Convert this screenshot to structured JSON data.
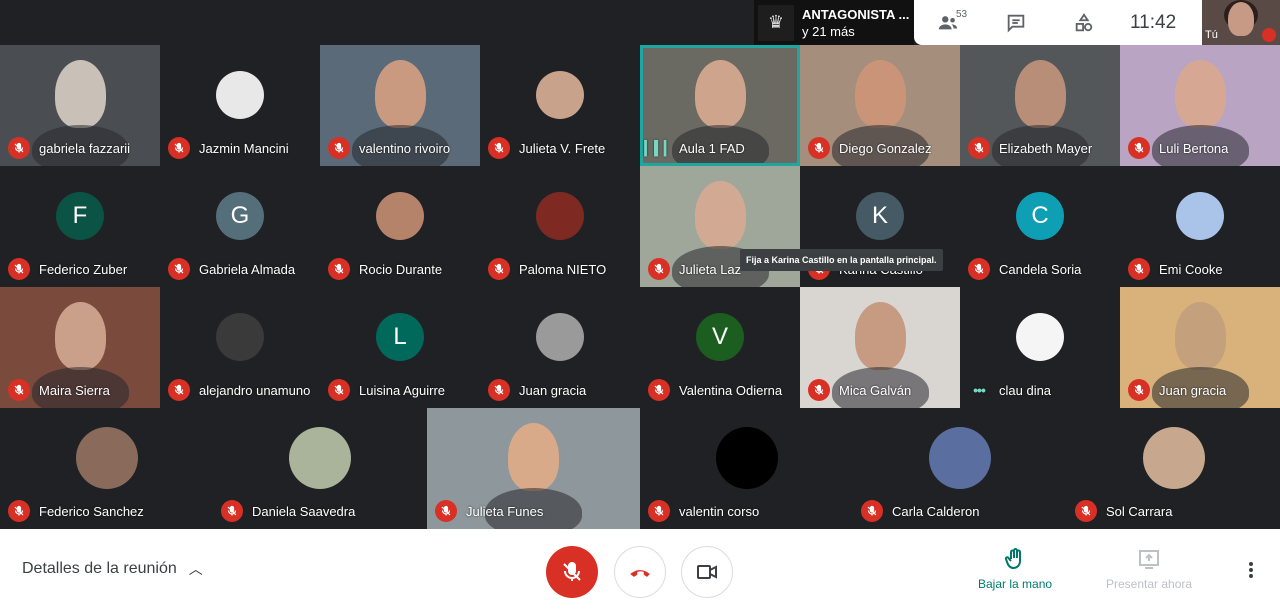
{
  "presenter": {
    "line1": "ANTAGONISTA ...",
    "line2": "y 21 más"
  },
  "toolbar": {
    "participants_count": "53",
    "time": "11:42"
  },
  "self_tile": {
    "label": "Tú"
  },
  "tooltip": "Fija a Karina Castillo en la pantalla principal.",
  "icons": [
    "people-icon",
    "chat-icon",
    "activities-icon",
    "mic-off-icon",
    "hangup-icon",
    "camera-icon",
    "raise-hand-icon",
    "present-icon",
    "more-icon",
    "chevron-up-icon"
  ],
  "colors": {
    "muted": "#d93025",
    "active_speaker": "#1ea7a0",
    "raise_hand": "#00796b"
  },
  "tiles": [
    {
      "name": "gabriela fazzarii"
    },
    {
      "name": "Jazmin Mancini"
    },
    {
      "name": "valentino rivoiro"
    },
    {
      "name": "Julieta V. Frete"
    },
    {
      "name": "Aula 1 FAD"
    },
    {
      "name": "Diego Gonzalez"
    },
    {
      "name": "Elizabeth Mayer"
    },
    {
      "name": "Luli Bertona"
    },
    {
      "name": "Federico Zuber",
      "initial": "F"
    },
    {
      "name": "Gabriela Almada",
      "initial": "G"
    },
    {
      "name": "Rocio Durante"
    },
    {
      "name": "Paloma NIETO"
    },
    {
      "name": "Julieta Laz"
    },
    {
      "name": "Karina Castillo",
      "initial": "K"
    },
    {
      "name": "Candela Soria",
      "initial": "C"
    },
    {
      "name": "Emi Cooke"
    },
    {
      "name": "Maira Sierra"
    },
    {
      "name": "alejandro unamuno"
    },
    {
      "name": "Luisina Aguirre",
      "initial": "L"
    },
    {
      "name": "Juan gracia"
    },
    {
      "name": "Valentina Odierna",
      "initial": "V"
    },
    {
      "name": "Mica Galván"
    },
    {
      "name": "clau dina"
    },
    {
      "name": "Juan gracia"
    },
    {
      "name": "Federico Sanchez"
    },
    {
      "name": "Daniela Saavedra"
    },
    {
      "name": "Julieta Funes"
    },
    {
      "name": "valentin corso"
    },
    {
      "name": "Carla Calderon"
    },
    {
      "name": "Sol Carrara"
    }
  ],
  "bottom": {
    "meeting_details": "Detalles de la reunión",
    "raise_hand": "Bajar la mano",
    "present_now": "Presentar ahora"
  }
}
